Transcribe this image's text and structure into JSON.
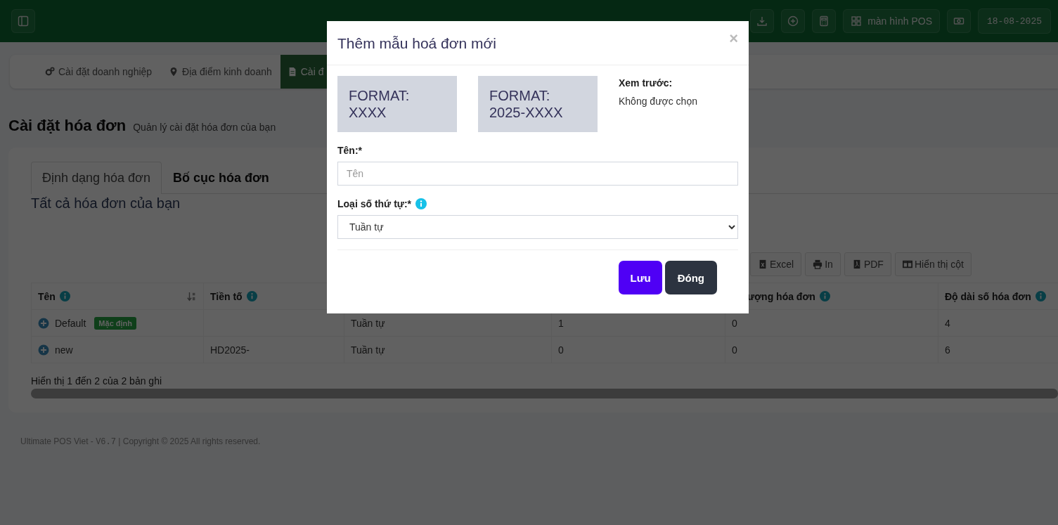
{
  "topbar": {
    "pos_button": "màn hình POS",
    "date": "18-08-2025"
  },
  "settings_nav": {
    "items": [
      {
        "label": "Cài đặt doanh nghiệp",
        "selected": false
      },
      {
        "label": "Địa điểm kinh doanh",
        "selected": false
      },
      {
        "label": "Cài đ",
        "selected": true
      }
    ]
  },
  "page_header": {
    "title": "Cài đặt hóa đơn",
    "subtitle": "Quản lý cài đặt hóa đơn của bạn"
  },
  "tabs": [
    {
      "label": "Định dạng hóa đơn",
      "selected": true
    },
    {
      "label": "Bố cục hóa đơn",
      "selected": false
    }
  ],
  "section_title": "Tất cả hóa đơn của bạn",
  "export_buttons": [
    "Excel",
    "In",
    "PDF",
    "Hiển thị cột"
  ],
  "table": {
    "columns": [
      {
        "label": "Tên"
      },
      {
        "label": "Tiền tố"
      },
      {},
      {},
      {
        "label": "ượng hóa đơn"
      },
      {
        "label": "Độ dài số hóa đơn"
      }
    ],
    "rows": [
      {
        "name": "Default",
        "badge": "Mặc định",
        "column_3": "Tuần tự",
        "column_4": "1",
        "column_5": "0",
        "column_6": "4"
      },
      {
        "name": "new",
        "prefix": "HD2025-",
        "column_3": "Tuần tự",
        "column_4": "0",
        "column_5": "0",
        "column_6": "6"
      }
    ],
    "info": "Hiển thị 1 đến 2 của 2 bản ghi"
  },
  "footer": {
    "before": "Ultimate POS Viet - ",
    "version": "V6.7",
    "after": " | Copyright © 2025 All rights reserved."
  },
  "modal": {
    "title": "Thêm mẫu hoá đơn mới",
    "close": "×",
    "formats": [
      {
        "label": "FORMAT:",
        "value": "XXXX"
      },
      {
        "label": "FORMAT:",
        "value": "2025-XXXX"
      }
    ],
    "preview_label": "Xem trước:",
    "preview_value": "Không được chọn",
    "name_label": "Tên:*",
    "name_placeholder": "Tên",
    "number_type_label": "Loại số thứ tự:*",
    "number_type_value": "Tuần tự",
    "buttons": [
      {
        "label": "Lưu",
        "kind": "primary"
      },
      {
        "label": "Đóng",
        "kind": "secondary"
      }
    ]
  }
}
